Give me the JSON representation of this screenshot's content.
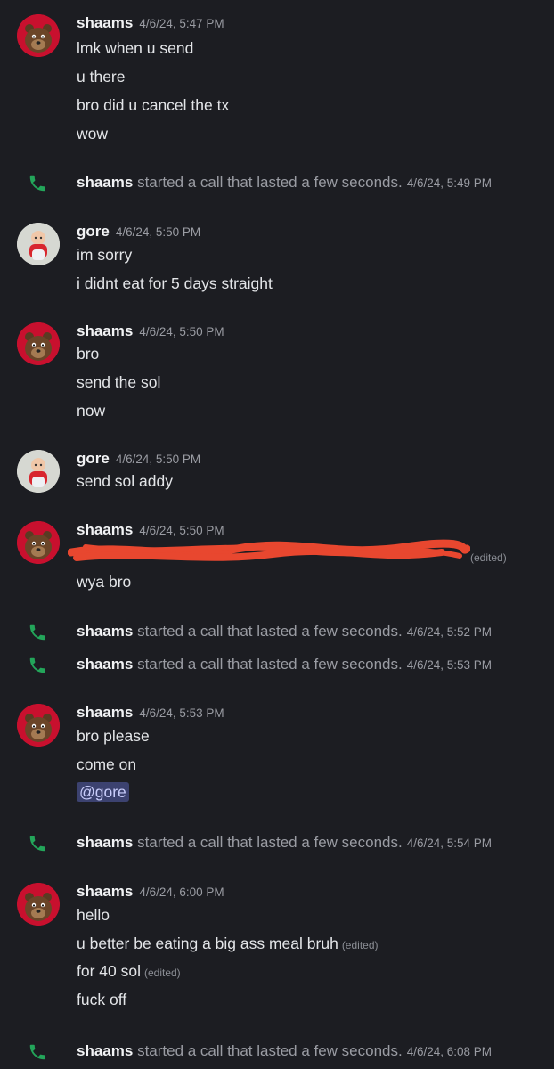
{
  "colors": {
    "background": "#1c1d22",
    "call_icon": "#23a55a",
    "mention_bg": "#3c4270",
    "redaction": "#e8472f"
  },
  "messages": [
    {
      "author": "shaams",
      "ts": "4/6/24, 5:47 PM",
      "lines": [
        "lmk when u send",
        "u there",
        "bro did u cancel the tx",
        "wow"
      ]
    },
    {
      "call_author": "shaams",
      "call_text": "started a call that lasted a few seconds.",
      "call_ts": "4/6/24, 5:49 PM"
    },
    {
      "author": "gore",
      "ts": "4/6/24, 5:50 PM",
      "lines": [
        "im sorry",
        "i didnt eat for 5 days straight"
      ]
    },
    {
      "author": "shaams",
      "ts": "4/6/24, 5:50 PM",
      "lines": [
        "bro",
        "send the sol",
        "now"
      ]
    },
    {
      "author": "gore",
      "ts": "4/6/24, 5:50 PM",
      "lines": [
        "send sol addy"
      ]
    },
    {
      "author": "shaams",
      "ts": "4/6/24, 5:50 PM",
      "edited": "(edited)",
      "lines": [
        "wya bro"
      ]
    },
    {
      "call_author": "shaams",
      "call_text": "started a call that lasted a few seconds.",
      "call_ts": "4/6/24, 5:52 PM"
    },
    {
      "call_author": "shaams",
      "call_text": "started a call that lasted a few seconds.",
      "call_ts": "4/6/24, 5:53 PM"
    },
    {
      "author": "shaams",
      "ts": "4/6/24, 5:53 PM",
      "lines": [
        "bro please",
        "come on"
      ],
      "mention": "@gore"
    },
    {
      "call_author": "shaams",
      "call_text": "started a call that lasted a few seconds.",
      "call_ts": "4/6/24, 5:54 PM"
    },
    {
      "author": "shaams",
      "ts": "4/6/24, 6:00 PM",
      "lines": [
        "hello",
        "u better be eating a big ass meal bruh",
        "for 40 sol",
        "fuck off"
      ],
      "edited_1": "(edited)",
      "edited_2": "(edited)"
    },
    {
      "call_author": "shaams",
      "call_text": "started a call that lasted a few seconds.",
      "call_ts": "4/6/24, 6:08 PM"
    }
  ],
  "icons": {
    "call": "phone-icon",
    "bear_avatar": "bear-avatar-icon",
    "gore_avatar": "baby-avatar-icon"
  }
}
